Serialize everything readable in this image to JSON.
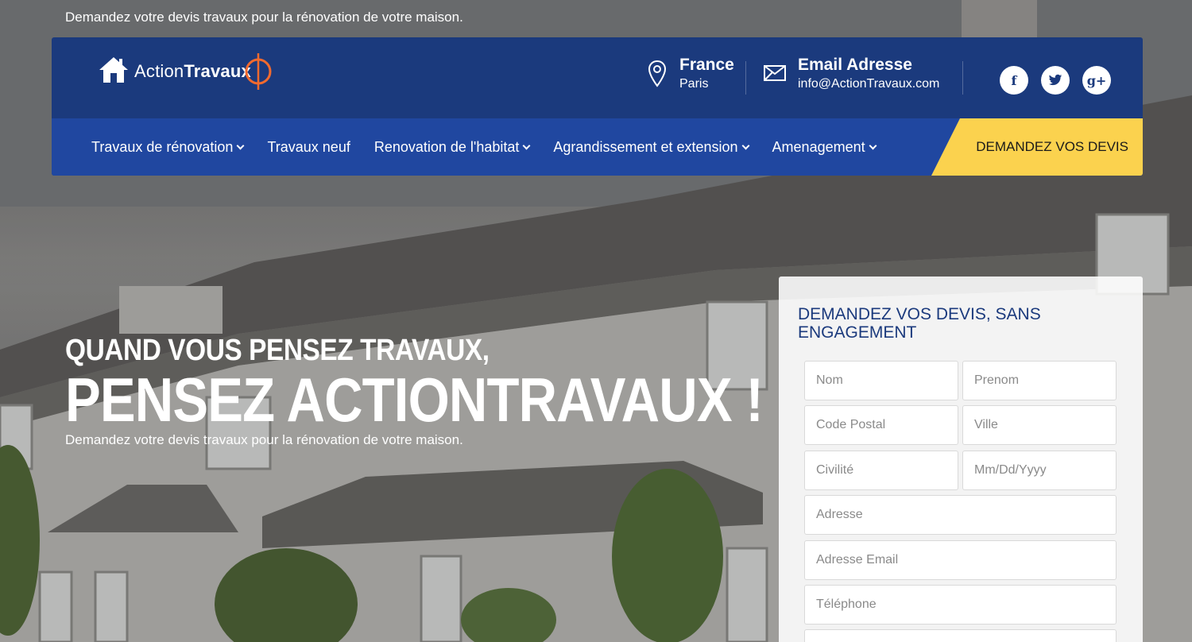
{
  "top_tagline": "Demandez votre devis travaux pour la rénovation de votre maison.",
  "brand": {
    "logo_text_light": "Action",
    "logo_text_bold": "Travaux"
  },
  "contact": {
    "location_title": "France",
    "location_sub": "Paris",
    "email_title": "Email Adresse",
    "email_sub": "info@ActionTravaux.com"
  },
  "socials": {
    "facebook": "f",
    "twitter": "t",
    "googleplus": "g+"
  },
  "nav": {
    "items": [
      {
        "label": "Travaux de rénovation",
        "has_dropdown": true
      },
      {
        "label": "Travaux neuf",
        "has_dropdown": false
      },
      {
        "label": "Renovation de l'habitat",
        "has_dropdown": true
      },
      {
        "label": "Agrandissement et extension",
        "has_dropdown": true
      },
      {
        "label": "Amenagement",
        "has_dropdown": true
      }
    ],
    "cta_label": "DEMANDEZ VOS DEVIS"
  },
  "hero": {
    "line1": "QUAND VOUS PENSEZ TRAVAUX,",
    "line2": "PENSEZ ACTIONTRAVAUX !",
    "description": "Demandez votre devis travaux pour la rénovation de votre maison."
  },
  "form": {
    "title": "DEMANDEZ VOS DEVIS, SANS ENGAGEMENT",
    "nom_placeholder": "Nom",
    "prenom_placeholder": "Prenom",
    "code_postal_placeholder": "Code Postal",
    "ville_placeholder": "Ville",
    "civilite_placeholder": "Civilité",
    "date_placeholder": "Mm/Dd/Yyyy",
    "adresse_placeholder": "Adresse",
    "email_placeholder": "Adresse Email",
    "telephone_placeholder": "Téléphone"
  },
  "colors": {
    "header_dark_blue": "#1b3a7d",
    "nav_blue": "#2047a0",
    "cta_yellow": "#fbd24e",
    "logo_accent": "#f26a2e"
  }
}
